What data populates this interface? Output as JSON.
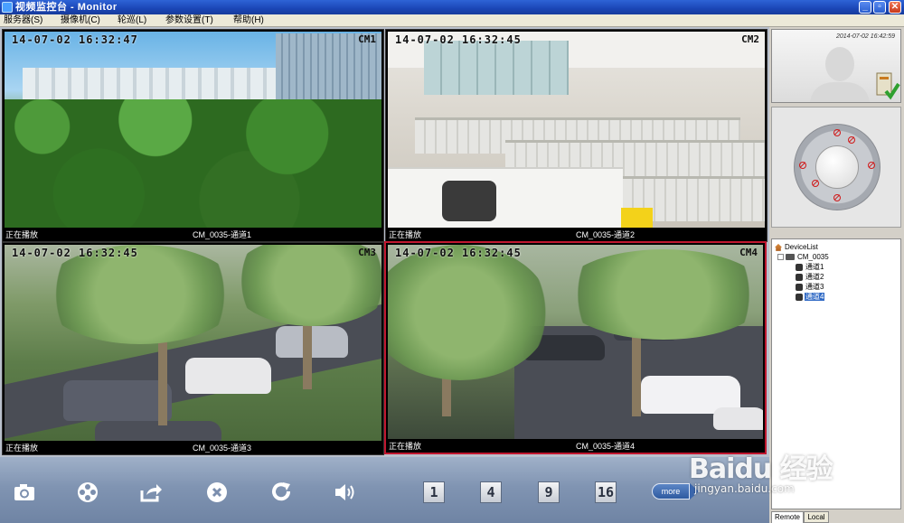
{
  "window": {
    "title": "视频监控台 - Monitor"
  },
  "menu": [
    {
      "label": "服务器(S)"
    },
    {
      "label": "摄像机(C)"
    },
    {
      "label": "轮巡(L)"
    },
    {
      "label": "参数设置(T)"
    },
    {
      "label": "帮助(H)"
    }
  ],
  "cameras": [
    {
      "timestamp": "14-07-02 16:32:47",
      "id": "CM1",
      "status": "正在播放",
      "channel": "CM_0035-通道1"
    },
    {
      "timestamp": "14-07-02 16:32:45",
      "id": "CM2",
      "status": "正在播放",
      "channel": "CM_0035-通道2"
    },
    {
      "timestamp": "14-07-02 16:32:45",
      "id": "CM3",
      "status": "正在播放",
      "channel": "CM_0035-通道3"
    },
    {
      "timestamp": "14-07-02 16:32:45",
      "id": "CM4",
      "status": "正在播放",
      "channel": "CM_0035-通道4"
    }
  ],
  "preview": {
    "timestamp": "2014-07-02   16:42:59"
  },
  "device_tree": {
    "root": "DeviceList",
    "device": "CM_0035",
    "channels": [
      "通道1",
      "通道2",
      "通道3",
      "通道4"
    ],
    "selected": "通道4"
  },
  "tabs": [
    {
      "label": "Remote"
    },
    {
      "label": "Local"
    }
  ],
  "toolbar": {
    "icons": [
      "camera-icon",
      "record-icon",
      "share-icon",
      "stop-icon",
      "refresh-icon",
      "volume-icon"
    ],
    "split_buttons": [
      "1",
      "4",
      "9",
      "16"
    ],
    "more_label": "more"
  },
  "watermark": {
    "logo": "Baidu 经验",
    "url": "jingyan.baidu.com"
  },
  "colors": {
    "titlebar": "#1b46b6",
    "active_border": "#c0172f",
    "selection": "#316ac5",
    "toolbar": "#8094b2"
  }
}
